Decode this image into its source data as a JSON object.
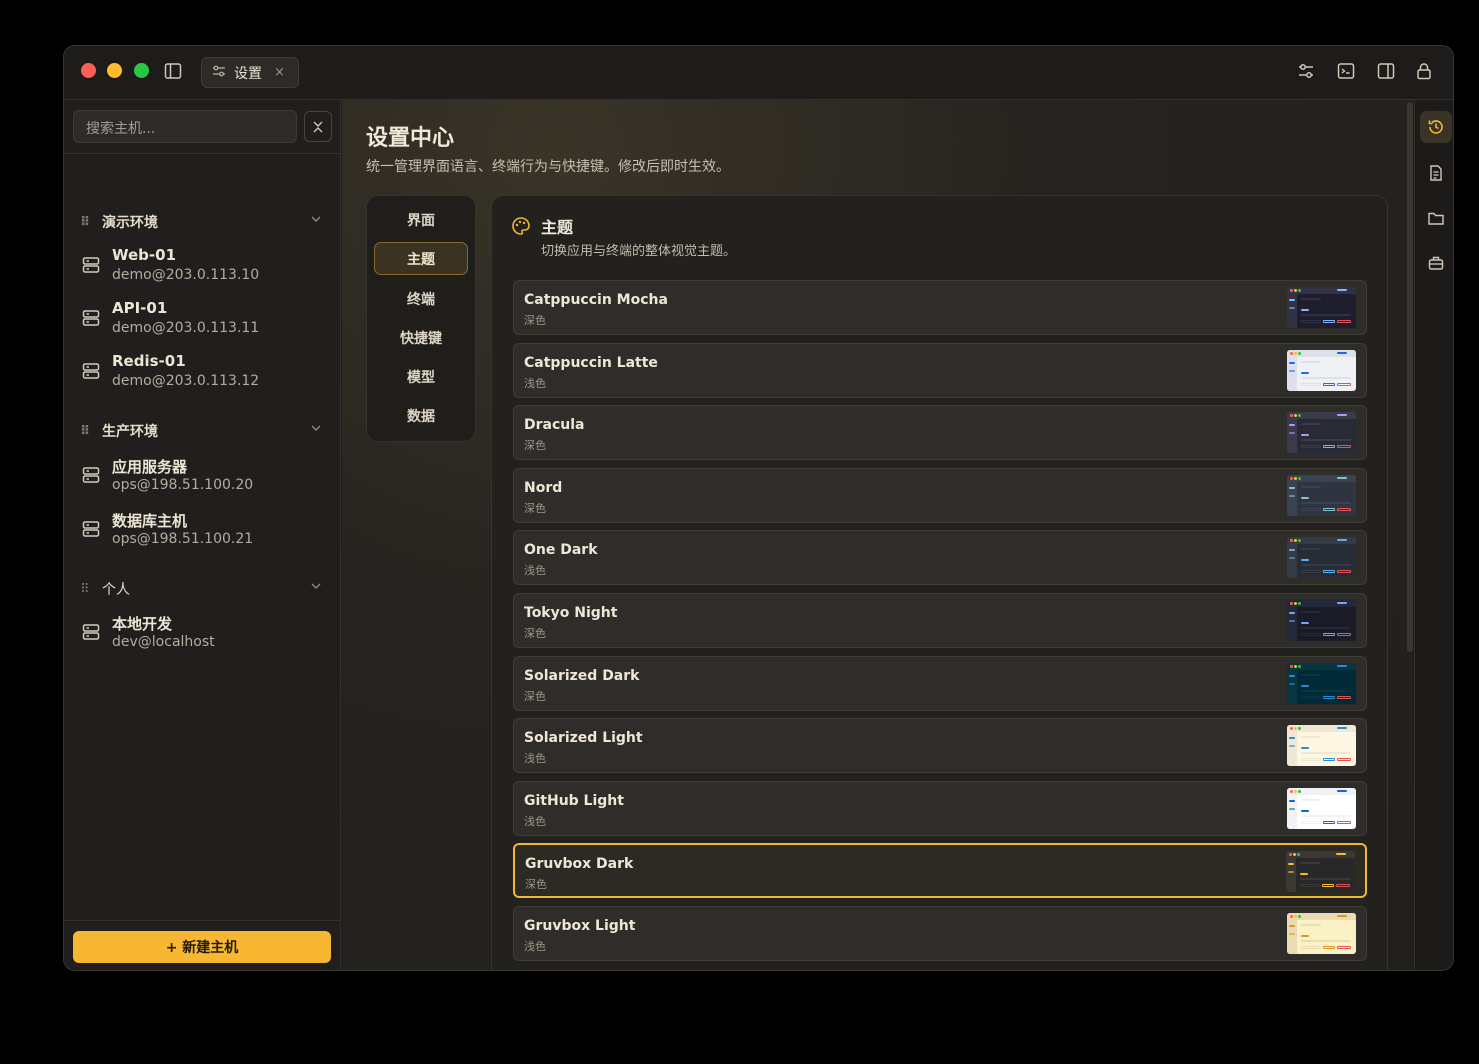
{
  "window": {
    "tab_label": "设置",
    "tab_close": "×",
    "toolbar_icons": [
      "sliders-icon",
      "terminal-icon",
      "split-view-icon",
      "lock-icon"
    ]
  },
  "sidebar": {
    "search_placeholder": "搜索主机...",
    "groups": [
      {
        "name": "演示环境",
        "hosts": [
          {
            "name": "Web-01",
            "address": "demo@203.0.113.10"
          },
          {
            "name": "API-01",
            "address": "demo@203.0.113.11"
          },
          {
            "name": "Redis-01",
            "address": "demo@203.0.113.12"
          }
        ]
      },
      {
        "name": "生产环境",
        "hosts": [
          {
            "name": "应用服务器",
            "address": "ops@198.51.100.20"
          },
          {
            "name": "数据库主机",
            "address": "ops@198.51.100.21"
          }
        ]
      },
      {
        "name": "个人",
        "hosts": [
          {
            "name": "本地开发",
            "address": "dev@localhost"
          }
        ]
      }
    ],
    "new_host_label": "+ 新建主机"
  },
  "main": {
    "title": "设置中心",
    "subtitle": "统一管理界面语言、终端行为与快捷键。修改后即时生效。",
    "nav": [
      "界面",
      "主题",
      "终端",
      "快捷键",
      "模型",
      "数据"
    ],
    "active_nav": "主题",
    "panel": {
      "title": "主题",
      "subtitle": "切换应用与终端的整体视觉主题。",
      "themes": [
        {
          "name": "Catppuccin Mocha",
          "kind": "深色",
          "bg": "#1e1e2e",
          "fg": "#313244",
          "accent": "#89b4fa"
        },
        {
          "name": "Catppuccin Latte",
          "kind": "浅色",
          "bg": "#eff1f5",
          "fg": "#dce0e8",
          "accent": "#1e66f5"
        },
        {
          "name": "Dracula",
          "kind": "深色",
          "bg": "#282a36",
          "fg": "#3a3c4e",
          "accent": "#bd93f9"
        },
        {
          "name": "Nord",
          "kind": "深色",
          "bg": "#2e3440",
          "fg": "#3b4252",
          "accent": "#88c0d0"
        },
        {
          "name": "One Dark",
          "kind": "浅色",
          "bg": "#282c34",
          "fg": "#353b45",
          "accent": "#61afef"
        },
        {
          "name": "Tokyo Night",
          "kind": "深色",
          "bg": "#1a1b26",
          "fg": "#24283b",
          "accent": "#7aa2f7"
        },
        {
          "name": "Solarized Dark",
          "kind": "深色",
          "bg": "#002b36",
          "fg": "#073642",
          "accent": "#268bd2"
        },
        {
          "name": "Solarized Light",
          "kind": "浅色",
          "bg": "#fdf6e3",
          "fg": "#eee8d5",
          "accent": "#268bd2"
        },
        {
          "name": "GitHub Light",
          "kind": "浅色",
          "bg": "#ffffff",
          "fg": "#f0f2f5",
          "accent": "#0969da"
        },
        {
          "name": "Gruvbox Dark",
          "kind": "深色",
          "bg": "#282828",
          "fg": "#3c3836",
          "accent": "#fabd2f",
          "selected": true
        },
        {
          "name": "Gruvbox Light",
          "kind": "浅色",
          "bg": "#fbf1c7",
          "fg": "#ebdbb2",
          "accent": "#d79921"
        }
      ]
    }
  },
  "rail": {
    "icons": [
      "history-icon",
      "document-icon",
      "folder-icon",
      "toolbox-icon"
    ],
    "active_icon": "history-icon"
  },
  "colors": {
    "accent": "#f7b733",
    "traffic_red": "#fe5f57",
    "traffic_yellow": "#febc2e",
    "traffic_green": "#28c840"
  }
}
